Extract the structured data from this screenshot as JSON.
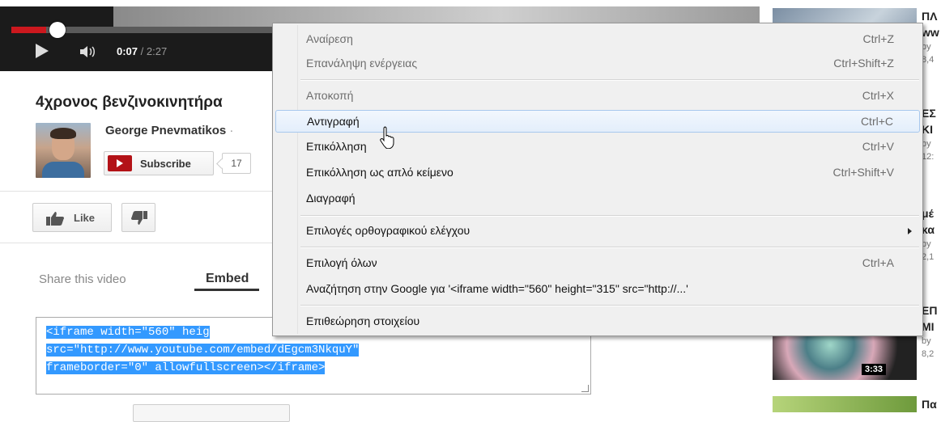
{
  "player": {
    "time_current": "0:07",
    "time_total": " / 2:27",
    "progress_fraction": 0.047,
    "colors": {
      "progress": "#cc181e",
      "buffer": "#e8b23a"
    }
  },
  "video": {
    "title": "4χρονος βενζινοκινητήρα",
    "channel": "George Pnevmatikos",
    "channel_separator": " ·",
    "subscribe_label": "Subscribe",
    "subscriber_count": "17",
    "like_label": "Like"
  },
  "share": {
    "share_tab": "Share this video",
    "embed_tab": "Embed",
    "embed_lines": [
      "<iframe width=\"560\" heig",
      "src=\"http://www.youtube.com/embed/dEgcm3NkquY\"",
      "frameborder=\"0\" allowfullscreen></iframe>"
    ]
  },
  "sidebar": {
    "items": [
      {
        "line1": "ΠΛ",
        "line2": "ww",
        "meta1": "by",
        "meta2": "8,4"
      },
      {
        "line1": "ΕΣ",
        "line2": "ΚΙ",
        "meta1": "by",
        "meta2": "12:"
      },
      {
        "line1": "μέ",
        "line2": "κα",
        "meta1": "by",
        "meta2": "2,1"
      },
      {
        "line1": "ΕΠ",
        "line2": "ΜΙ",
        "meta1": "by",
        "meta2": "8,2",
        "duration": "3:33"
      },
      {
        "line1": "Πα",
        "line2": "",
        "meta1": "",
        "meta2": ""
      }
    ]
  },
  "context_menu": {
    "items": [
      {
        "label": "Αναίρεση",
        "shortcut": "Ctrl+Z",
        "disabled": true
      },
      {
        "label": "Επανάληψη ενέργειας",
        "shortcut": "Ctrl+Shift+Z",
        "disabled": true
      },
      {
        "label": "Αποκοπή",
        "shortcut": "Ctrl+X",
        "disabled": true
      },
      {
        "label": "Αντιγραφή",
        "shortcut": "Ctrl+C",
        "disabled": false,
        "highlighted": true
      },
      {
        "label": "Επικόλληση",
        "shortcut": "Ctrl+V",
        "disabled": false
      },
      {
        "label": "Επικόλληση ως απλό κείμενο",
        "shortcut": "Ctrl+Shift+V",
        "disabled": false
      },
      {
        "label": "Διαγραφή",
        "shortcut": "",
        "disabled": false
      },
      {
        "label": "Επιλογές ορθογραφικού ελέγχου",
        "shortcut": "",
        "disabled": false,
        "submenu": true
      },
      {
        "label": "Επιλογή όλων",
        "shortcut": "Ctrl+A",
        "disabled": false
      },
      {
        "label": "Αναζήτηση στην Google για '<iframe width=\"560\" height=\"315\" src=\"http://...'",
        "shortcut": "",
        "disabled": false
      },
      {
        "label": "Επιθεώρηση στοιχείου",
        "shortcut": "",
        "disabled": false
      }
    ]
  }
}
